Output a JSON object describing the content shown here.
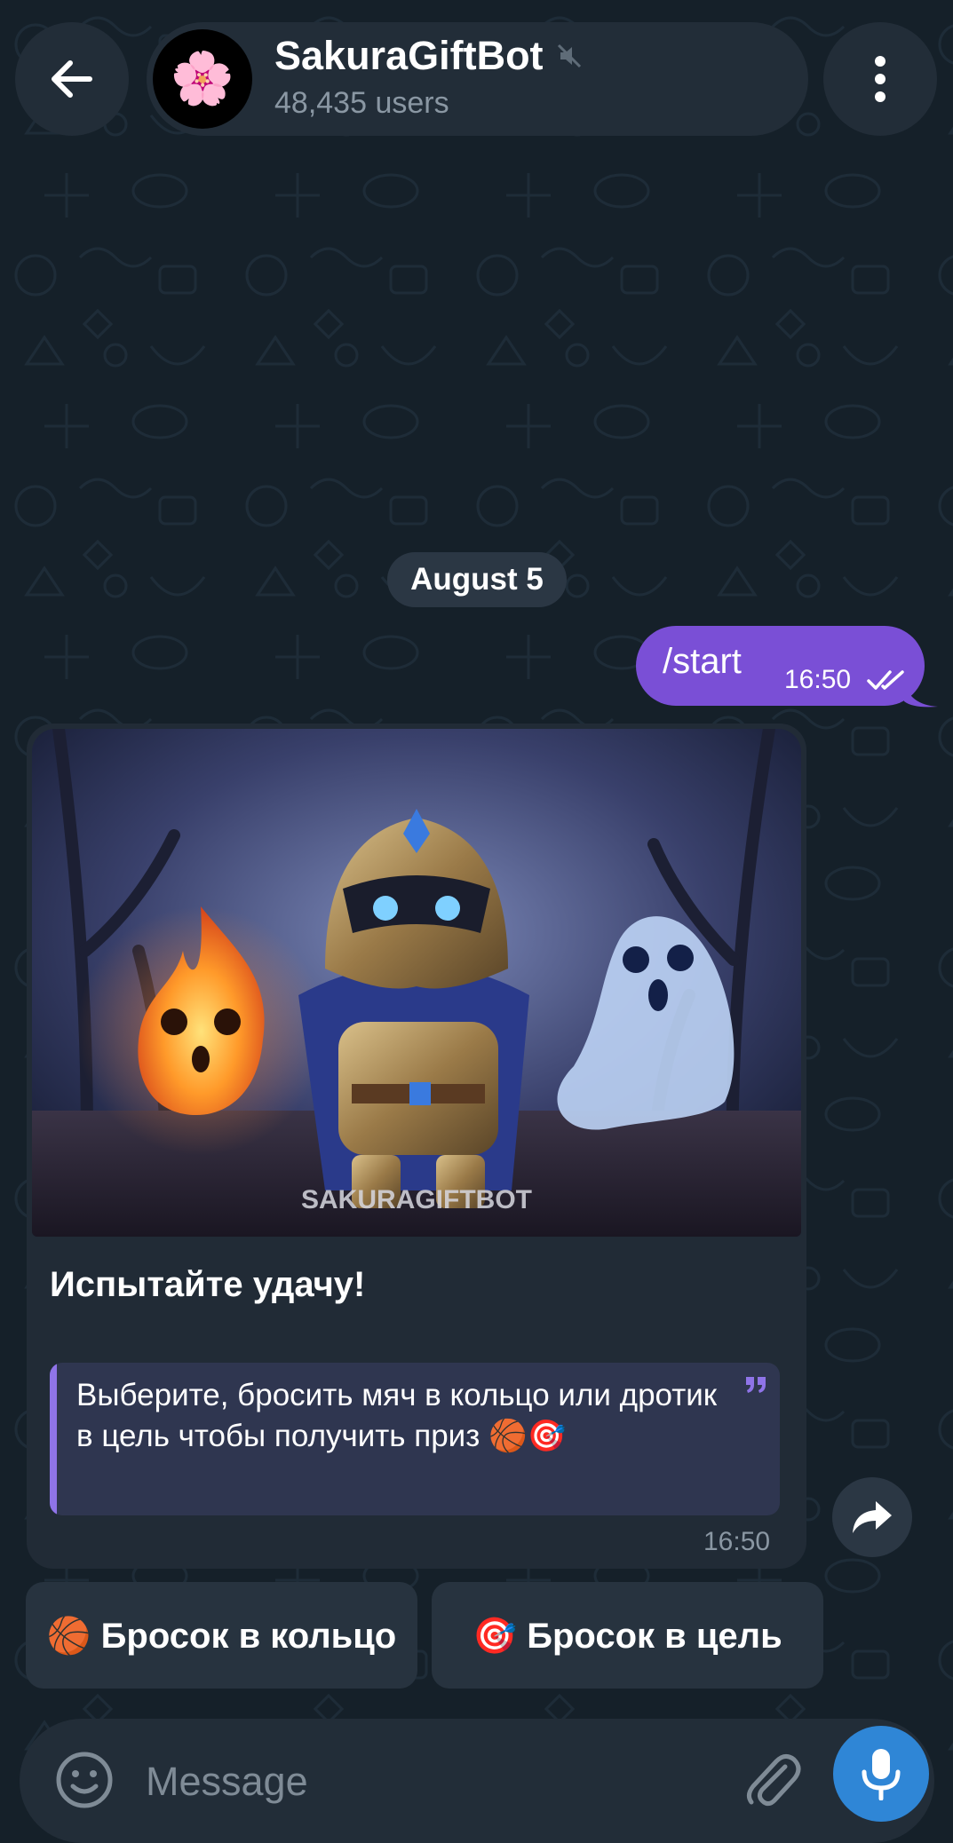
{
  "header": {
    "title": "SakuraGiftBot",
    "subtitle": "48,435 users",
    "avatar_emoji": "🌸",
    "muted": true
  },
  "date_separator": "August 5",
  "outgoing_message": {
    "text": "/start",
    "time": "16:50",
    "status": "read"
  },
  "incoming_message": {
    "image_watermark": "SAKURAGIFTBOT",
    "heading": "Испытайте удачу!",
    "quote_text": "Выберите, бросить мяч в кольцо или дротик в цель чтобы получить приз 🏀🎯",
    "time": "16:50"
  },
  "inline_keyboard": [
    {
      "label": "🏀 Бросок в кольцо"
    },
    {
      "label": "🎯 Бросок в цель"
    }
  ],
  "composer": {
    "placeholder": "Message"
  },
  "colors": {
    "background": "#152029",
    "surface": "#222d38",
    "outgoing_bubble": "#7a4fd6",
    "quote_accent": "#8f74e8",
    "mic_button": "#2f86d6"
  }
}
